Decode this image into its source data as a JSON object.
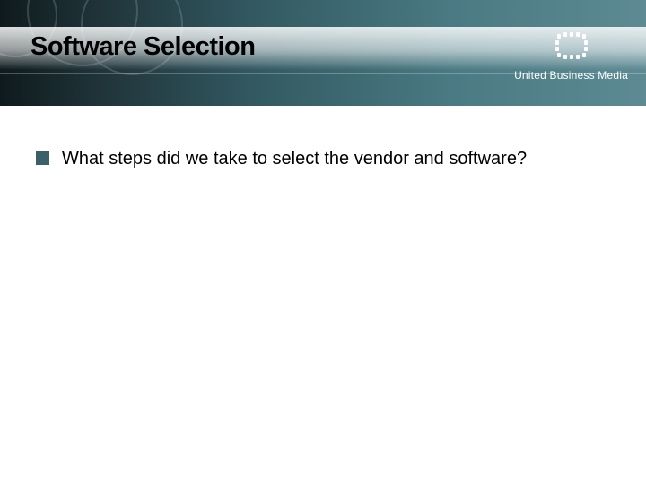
{
  "header": {
    "title": "Software Selection"
  },
  "brand": {
    "name": "United Business Media"
  },
  "bullets": {
    "items": [
      {
        "text": "What steps did we take to select the vendor and software?"
      }
    ]
  },
  "colors": {
    "accent": "#3a6169",
    "header_gradient_start": "#0f1a1d",
    "header_gradient_end": "#5d8a93"
  }
}
